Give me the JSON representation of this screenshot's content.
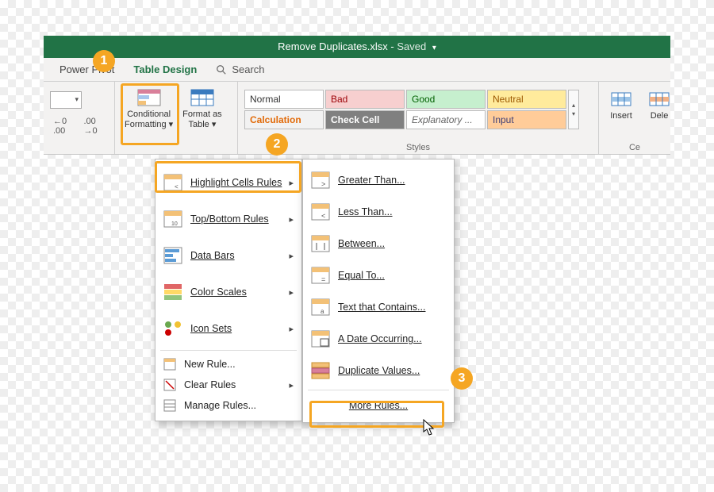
{
  "title": {
    "filename": "Remove Duplicates.xlsx",
    "status": "Saved"
  },
  "tabs": {
    "pivot": "Power Pivot",
    "design": "Table Design",
    "search": "Search"
  },
  "ribbon": {
    "cond_fmt": {
      "line1": "Conditional",
      "line2": "Formatting"
    },
    "fmt_table": {
      "line1": "Format as",
      "line2": "Table"
    },
    "styles_label": "Styles",
    "styles": {
      "normal": "Normal",
      "bad": "Bad",
      "good": "Good",
      "neutral": "Neutral",
      "calc": "Calculation",
      "check": "Check Cell",
      "expl": "Explanatory ...",
      "input": "Input"
    },
    "insert": "Insert",
    "delete": "Dele",
    "cells_label": "Ce"
  },
  "menu1": {
    "highlight": "Highlight Cells Rules",
    "topbottom": "Top/Bottom Rules",
    "databars": "Data Bars",
    "colorscales": "Color Scales",
    "iconsets": "Icon Sets",
    "newrule": "New Rule...",
    "clear": "Clear Rules",
    "manage": "Manage Rules..."
  },
  "menu2": {
    "gt": "Greater Than...",
    "lt": "Less Than...",
    "between": "Between...",
    "eq": "Equal To...",
    "text": "Text that Contains...",
    "date": "A Date Occurring...",
    "dup": "Duplicate Values...",
    "more": "More Rules..."
  },
  "badges": {
    "b1": "1",
    "b2": "2",
    "b3": "3"
  }
}
